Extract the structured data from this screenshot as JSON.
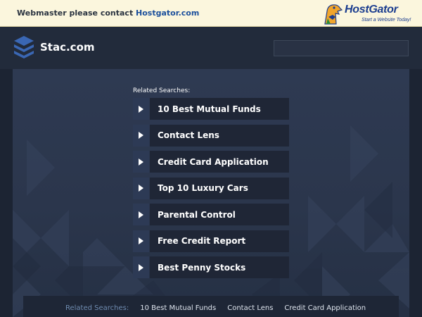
{
  "banner": {
    "prefix": "Webmaster please contact ",
    "link_text": "Hostgator.com",
    "logo_name": "HostGator",
    "logo_tagline": "Start a Website Today!"
  },
  "header": {
    "site_name": "Stac.com",
    "logo_icon": "stacked-layers-icon",
    "search_value": ""
  },
  "main": {
    "related_title": "Related Searches:",
    "links": [
      {
        "label": "10 Best Mutual Funds"
      },
      {
        "label": "Contact Lens"
      },
      {
        "label": "Credit Card Application"
      },
      {
        "label": "Top 10 Luxury Cars"
      },
      {
        "label": "Parental Control"
      },
      {
        "label": "Free Credit Report"
      },
      {
        "label": "Best Penny Stocks"
      }
    ]
  },
  "footer": {
    "title": "Related Searches:",
    "links": [
      {
        "label": "10 Best Mutual Funds"
      },
      {
        "label": "Contact Lens"
      },
      {
        "label": "Credit Card Application"
      }
    ]
  },
  "colors": {
    "banner_bg": "#fbf6dd",
    "banner_link": "#1b4f9c",
    "page_bg": "#1c2433",
    "header_bg": "#222b3b",
    "arrow_bg": "#2d3a55",
    "label_bg": "#1f2636",
    "footer_title": "#6f8bb0"
  }
}
